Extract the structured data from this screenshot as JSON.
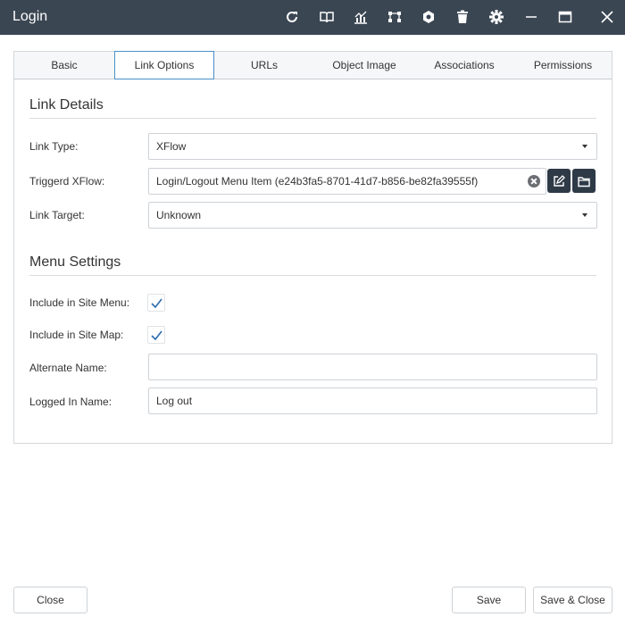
{
  "window": {
    "title": "Login",
    "toolbar_icons": [
      "refresh-icon",
      "book-icon",
      "chart-icon",
      "workflow-icon",
      "settings-cog-icon",
      "trash-icon",
      "gear-icon",
      "minimize-icon",
      "maximize-icon",
      "close-icon"
    ]
  },
  "tabs": [
    {
      "label": "Basic",
      "active": false
    },
    {
      "label": "Link Options",
      "active": true
    },
    {
      "label": "URLs",
      "active": false
    },
    {
      "label": "Object Image",
      "active": false
    },
    {
      "label": "Associations",
      "active": false
    },
    {
      "label": "Permissions",
      "active": false
    }
  ],
  "link_details": {
    "title": "Link Details",
    "link_type": {
      "label": "Link Type:",
      "value": "XFlow"
    },
    "triggered_xflow": {
      "label": "Triggerd XFlow:",
      "value": "Login/Logout Menu Item (e24b3fa5-8701-41d7-b856-be82fa39555f)"
    },
    "link_target": {
      "label": "Link Target:",
      "value": "Unknown"
    }
  },
  "menu_settings": {
    "title": "Menu Settings",
    "include_site_menu": {
      "label": "Include in Site Menu:",
      "checked": true
    },
    "include_site_map": {
      "label": "Include in Site Map:",
      "checked": true
    },
    "alternate_name": {
      "label": "Alternate Name:",
      "value": ""
    },
    "logged_in_name": {
      "label": "Logged In Name:",
      "value": "Log out"
    }
  },
  "footer": {
    "close_label": "Close",
    "save_label": "Save",
    "save_close_label": "Save & Close"
  },
  "colors": {
    "titlebar": "#3b4653",
    "accent": "#4a90c8",
    "check": "#2b6cb0",
    "dark_button": "#2f3a47"
  }
}
